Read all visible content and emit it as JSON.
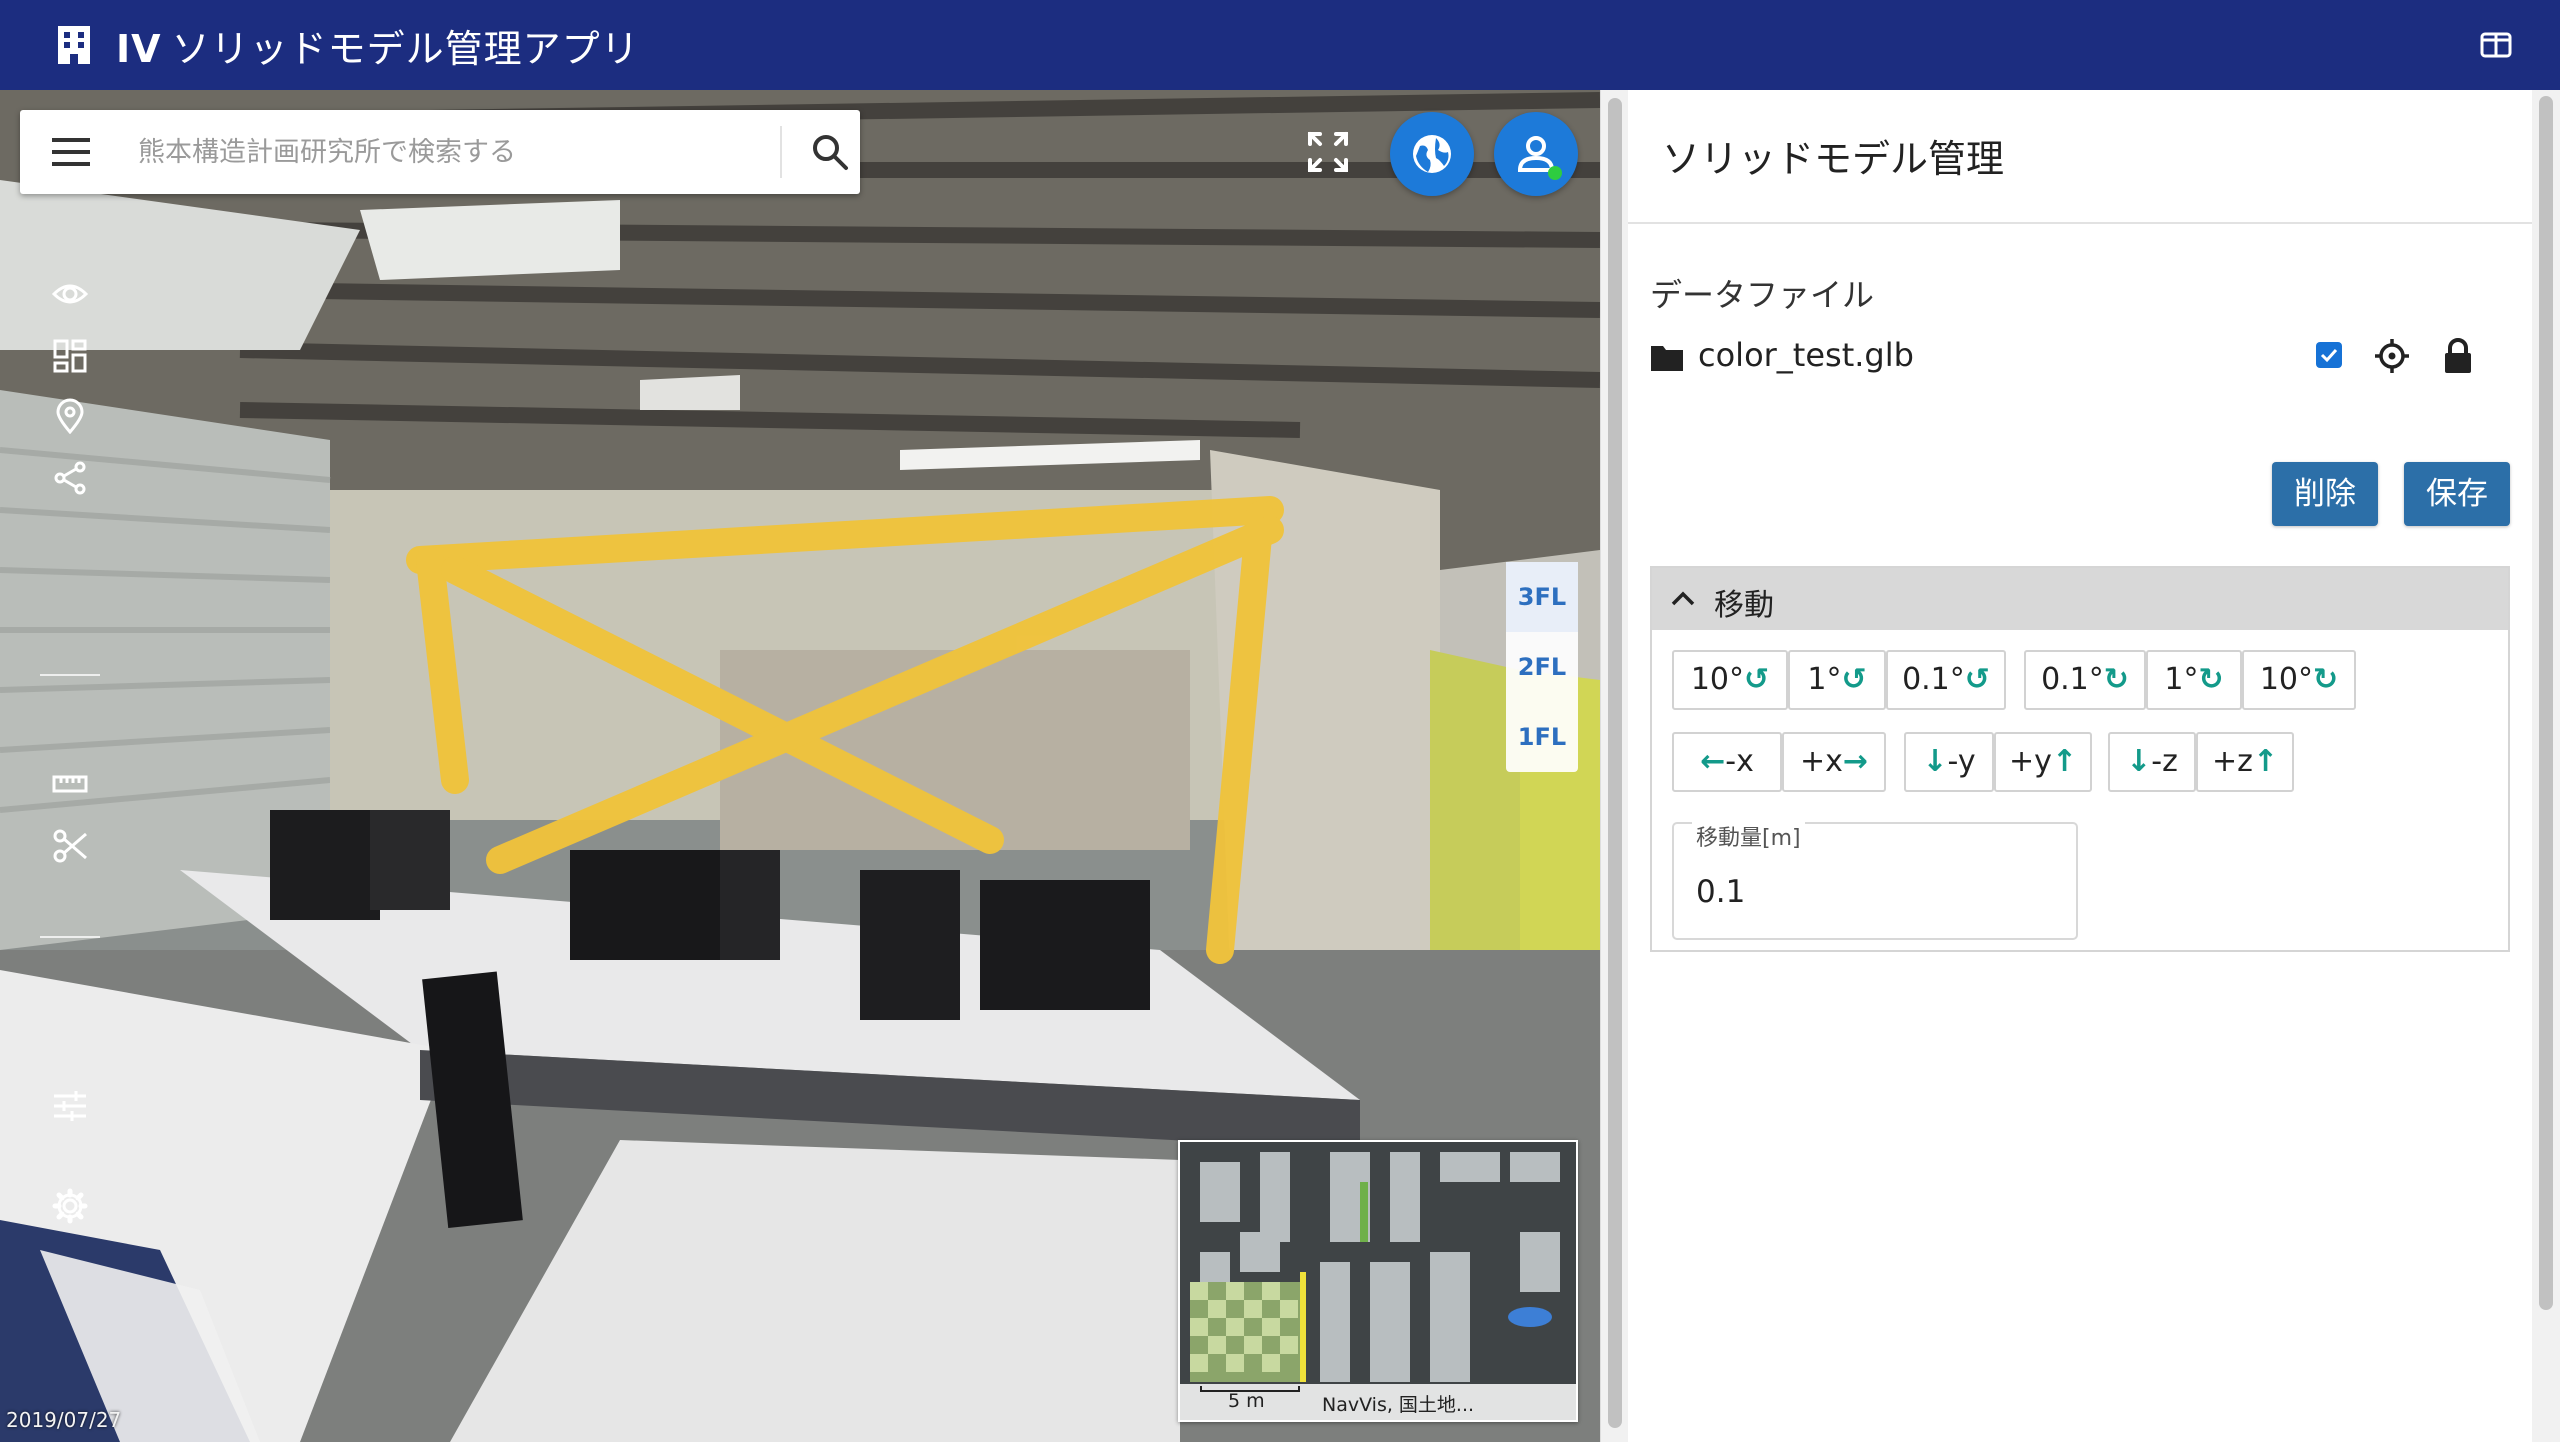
{
  "header": {
    "brand": "IV",
    "title": "ソリッドモデル管理アプリ",
    "color": "#1c2d80"
  },
  "search": {
    "placeholder": "熊本構造計画研究所で検索する"
  },
  "viewer": {
    "floors": [
      "3FL",
      "2FL",
      "1FL"
    ],
    "active_floor": "3FL",
    "date": "2019/07/27",
    "minimap": {
      "scale": "5 m",
      "credit": "NavVis, 国土地..."
    },
    "tools": [
      "eye-icon",
      "layers-icon",
      "map-pin-icon",
      "share-icon",
      "ruler-icon",
      "scissors-icon",
      "sliders-icon",
      "gear-icon"
    ],
    "accent": "#1d7ad9"
  },
  "panel": {
    "title": "ソリッドモデル管理",
    "data_file_label": "データファイル",
    "file": {
      "name": "color_test.glb",
      "visible": true
    },
    "delete_label": "削除",
    "save_label": "保存",
    "button_color": "#2c6fa8",
    "move": {
      "title": "移動",
      "rotate_ccw": [
        "10°",
        "1°",
        "0.1°"
      ],
      "rotate_cw": [
        "0.1°",
        "1°",
        "10°"
      ],
      "axes": [
        "-x",
        "+x",
        "-y",
        "+y",
        "-z",
        "+z"
      ],
      "amount_label": "移動量[m]",
      "amount_value": "0.1"
    }
  }
}
